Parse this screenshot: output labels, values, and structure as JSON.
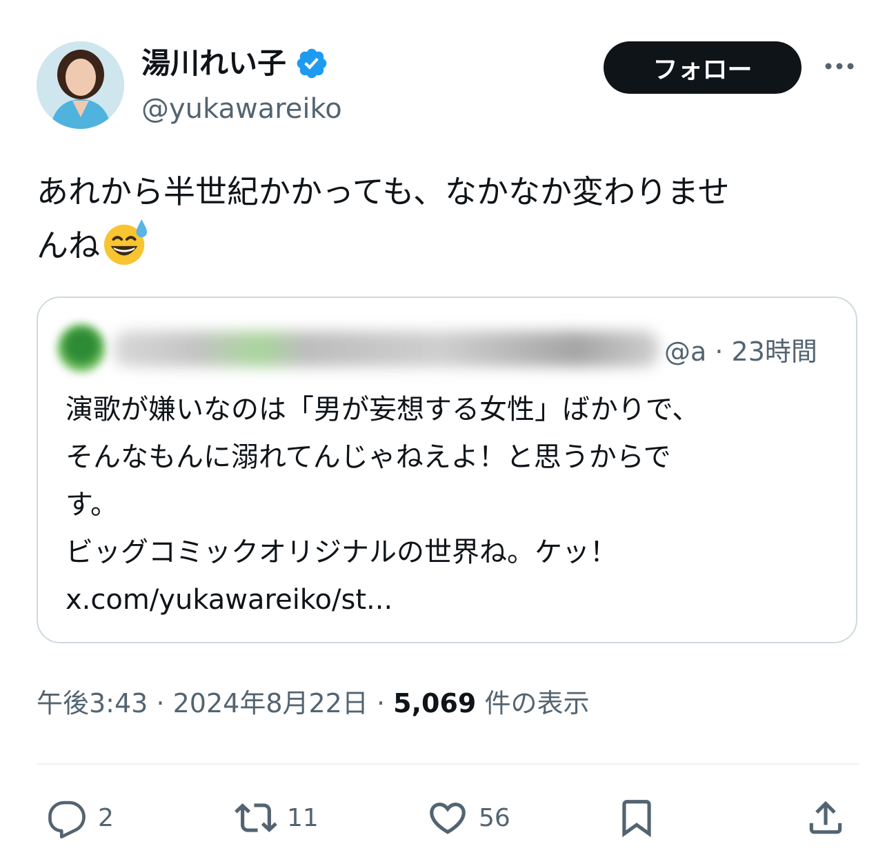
{
  "author": {
    "display_name": "湯川れい子",
    "handle": "@yukawareiko",
    "verified_icon": "verified-badge-icon",
    "verified_color": "#1d9bf0"
  },
  "follow_label": "フォロー",
  "more_icon": "more-dots-icon",
  "tweet": {
    "line1": "あれから半世紀かかっても、なかなか変わりませ",
    "line2": "んね",
    "emoji": "grinning-face-with-sweat-emoji"
  },
  "quoted": {
    "handle_prefix": "@a",
    "time": "· 23時間",
    "lines": [
      "演歌が嫌いなのは「男が妄想する女性」ばかりで、",
      "そんなもんに溺れてんじゃねえよ！と思うからで",
      "す。",
      "ビッグコミックオリジナルの世界ね。ケッ！",
      "x.com/yukawareiko/st..."
    ]
  },
  "meta": {
    "time": "午後3:43",
    "date": "2024年8月22日",
    "views_count": "5,069",
    "views_label": "件の表示"
  },
  "actions": {
    "reply_count": "2",
    "retweet_count": "11",
    "like_count": "56"
  }
}
